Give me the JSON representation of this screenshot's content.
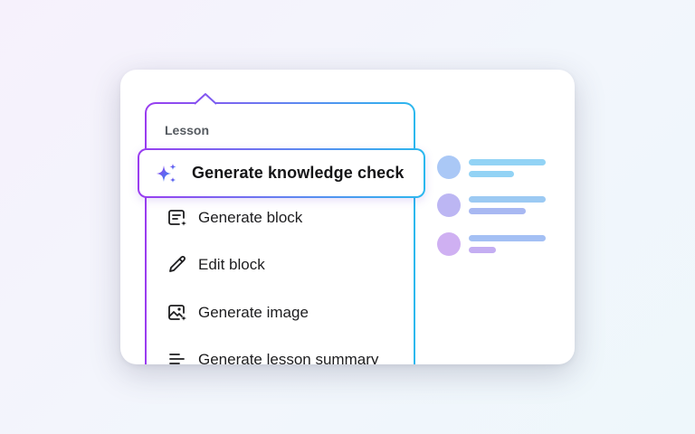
{
  "menu": {
    "section_label": "Lesson",
    "highlighted_item": {
      "label": "Generate knowledge check",
      "icon": "sparkles-icon"
    },
    "items": [
      {
        "label": "Generate block",
        "icon": "generate-block-icon"
      },
      {
        "label": "Edit block",
        "icon": "pencil-icon"
      },
      {
        "label": "Generate image",
        "icon": "generate-image-icon"
      },
      {
        "label": "Generate lesson summary",
        "icon": "summary-lines-icon"
      }
    ]
  },
  "colors": {
    "gradient_start": "#9a3cf0",
    "gradient_mid": "#5f86f0",
    "gradient_end": "#2bb8ee",
    "text_primary": "#1d1d1f",
    "section_label": "#555a60"
  }
}
